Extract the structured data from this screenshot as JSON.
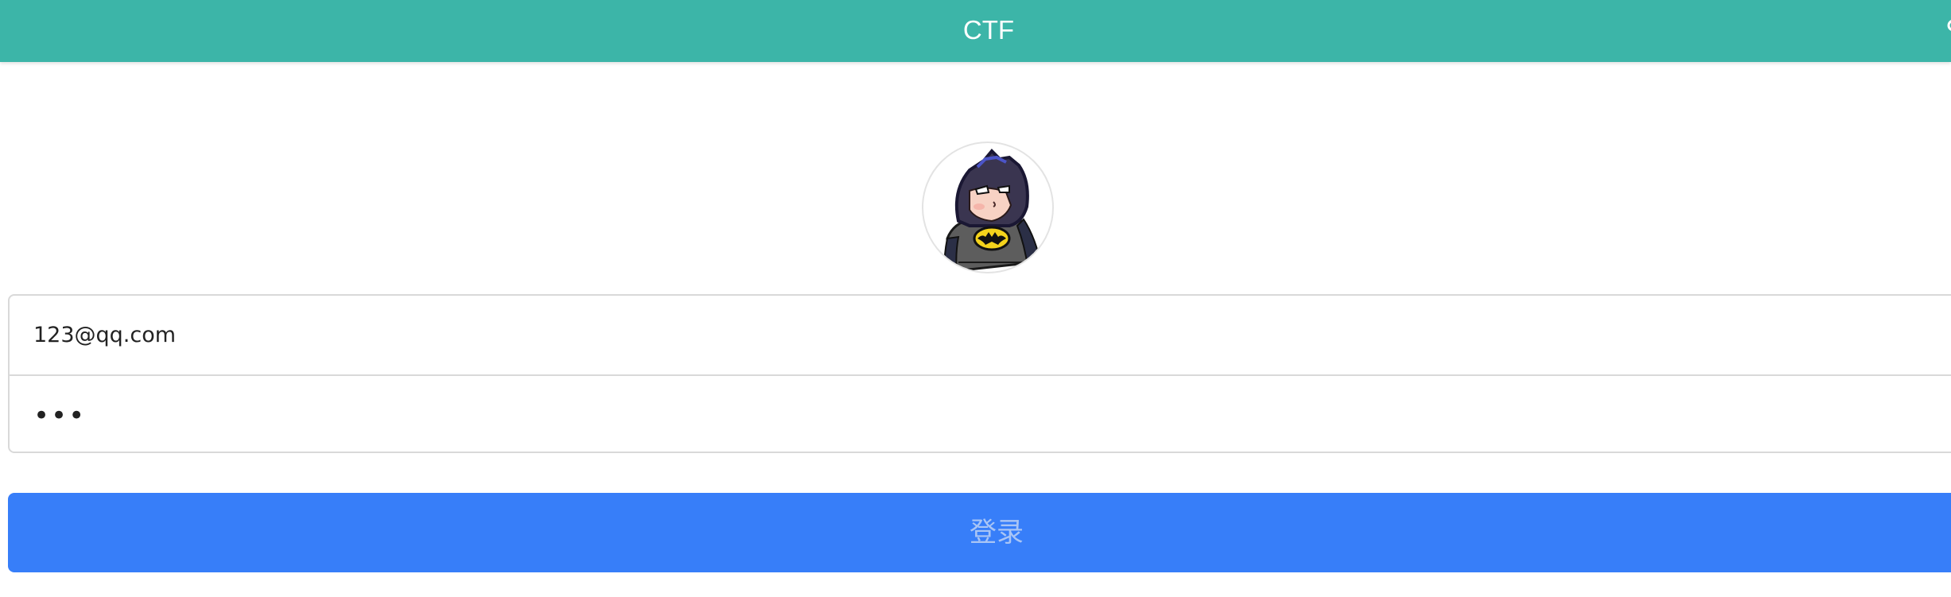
{
  "header": {
    "title": "CTF",
    "background_color": "#3cb5a8",
    "right_icon": "partial-icon"
  },
  "avatar": {
    "icon": "batman-avatar"
  },
  "login_form": {
    "email_value": "123@qq.com",
    "password_value": "•••"
  },
  "login_button": {
    "label": "登录",
    "color": "#377ef9"
  }
}
